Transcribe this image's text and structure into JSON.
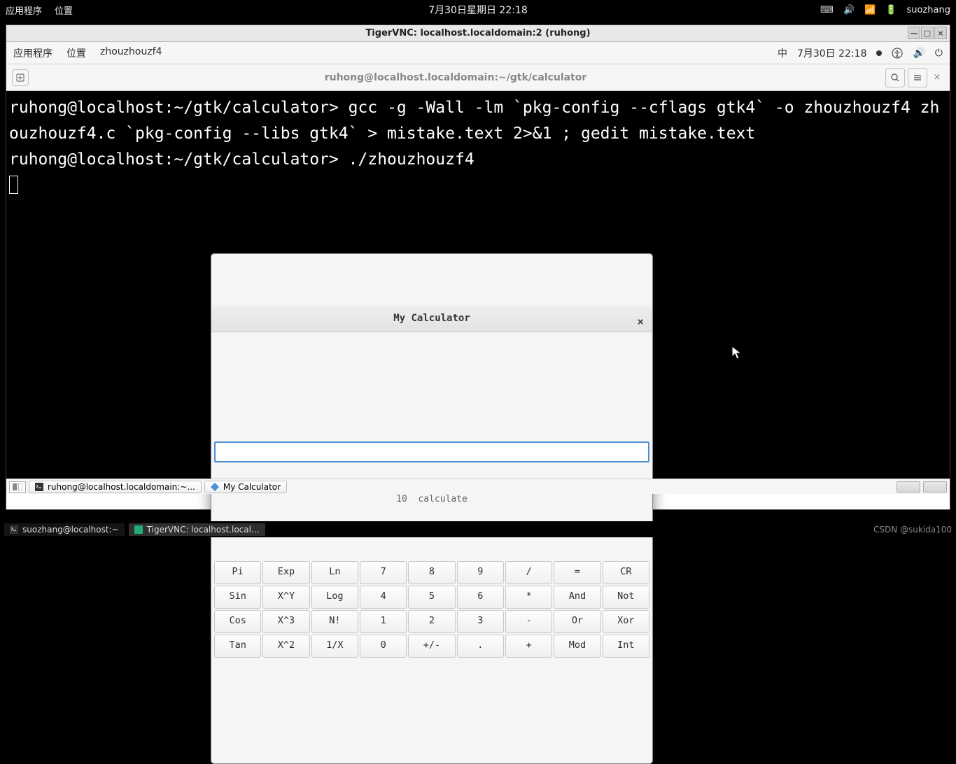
{
  "host_topbar": {
    "apps": "应用程序",
    "places": "位置",
    "datetime": "7月30日星期日 22:18",
    "username": "suozhang"
  },
  "vnc": {
    "title": "TigerVNC: localhost.localdomain:2 (ruhong)"
  },
  "gnome_topbar": {
    "apps": "应用程序",
    "places": "位置",
    "app_name": "zhouzhouzf4",
    "ime": "中",
    "datetime": "7月30日 22:18"
  },
  "term_toolbar": {
    "title": "ruhong@localhost.localdomain:~/gtk/calculator"
  },
  "terminal": {
    "prompt1": "ruhong@localhost:~/gtk/calculator> ",
    "cmd1": "gcc -g -Wall -lm `pkg-config --cflags gtk4` -o zhouzhouzf4 zhouzhouzf4.c `pkg-config --libs gtk4` > mistake.text 2>&1 ; gedit mistake.text",
    "prompt2": "ruhong@localhost:~/gtk/calculator> ",
    "cmd2": "./zhouzhouzf4"
  },
  "calc": {
    "title": "My Calculator",
    "input_value": "",
    "label": "10  calculate",
    "buttons": [
      "Pi",
      "Exp",
      "Ln",
      "7",
      "8",
      "9",
      "/",
      "=",
      "CR",
      "Sin",
      "X^Y",
      "Log",
      "4",
      "5",
      "6",
      "*",
      "And",
      "Not",
      "Cos",
      "X^3",
      "N!",
      "1",
      "2",
      "3",
      "-",
      "Or",
      "Xor",
      "Tan",
      "X^2",
      "1/X",
      "0",
      "+/-",
      ".",
      "+",
      "Mod",
      "Int"
    ]
  },
  "gnome_taskbar": {
    "task1": "ruhong@localhost.localdomain:~...",
    "task2": "My Calculator"
  },
  "host_taskbar": {
    "task1": "suozhang@localhost:~",
    "task2": "TigerVNC: localhost.local…",
    "watermark": "CSDN @sukida100"
  }
}
